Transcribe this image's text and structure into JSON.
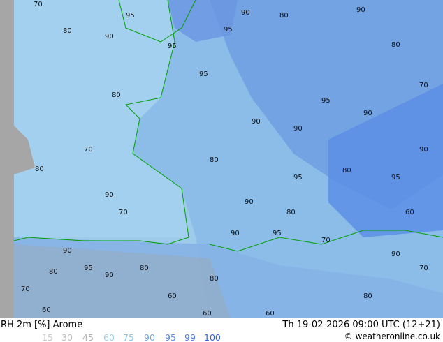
{
  "footer": {
    "title": "RH 2m [%] Arome",
    "datetime": "Th 19-02-2026 09:00 UTC (12+21)",
    "credit": "© weatheronline.co.uk"
  },
  "legend": [
    {
      "label": "15",
      "color": "#c8c8c8"
    },
    {
      "label": "30",
      "color": "#bebebe"
    },
    {
      "label": "45",
      "color": "#b4b4b4"
    },
    {
      "label": "60",
      "color": "#a0d2f0"
    },
    {
      "label": "75",
      "color": "#8cc3e6"
    },
    {
      "label": "90",
      "color": "#78aadf"
    },
    {
      "label": "95",
      "color": "#5a8ce6"
    },
    {
      "label": "99",
      "color": "#4678e6"
    },
    {
      "label": "100",
      "color": "#3264dc"
    }
  ],
  "colors": {
    "land_gray": "#a6a6a6",
    "coast": "#00a000",
    "sea": "#a8d0ec"
  },
  "contour_labels": [
    "70",
    "80",
    "95",
    "90",
    "80",
    "95",
    "95",
    "90",
    "80",
    "90",
    "70",
    "80",
    "95",
    "90",
    "80",
    "90",
    "95",
    "90",
    "80",
    "70",
    "60",
    "90",
    "80",
    "95",
    "90",
    "70",
    "80",
    "90",
    "95",
    "60",
    "80",
    "70",
    "90",
    "80",
    "60",
    "90",
    "95",
    "90",
    "70",
    "80",
    "60",
    "95",
    "90",
    "80",
    "70",
    "60"
  ]
}
